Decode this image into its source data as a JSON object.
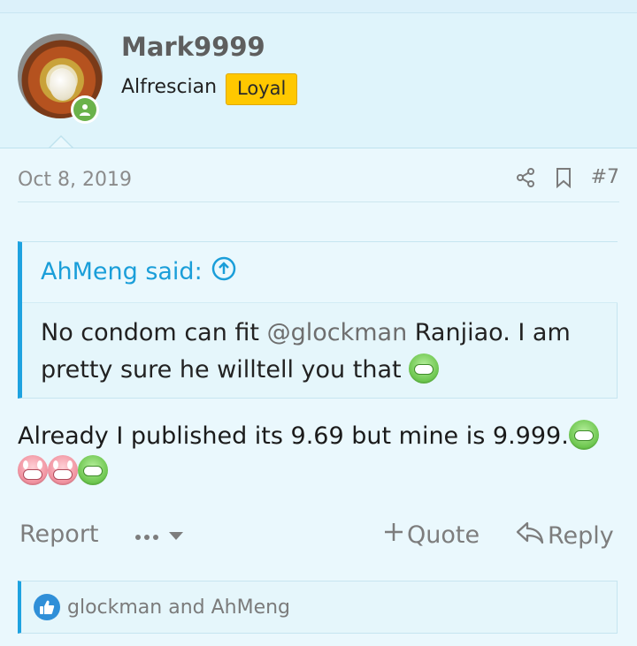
{
  "user": {
    "name": "Mark9999",
    "title": "Alfrescian",
    "badge": "Loyal"
  },
  "post": {
    "date": "Oct 8, 2019",
    "number": "#7",
    "text": "Already I published its 9.69 but mine is 9.999."
  },
  "quote": {
    "author": "AhMeng said:",
    "text_before": "No condom can fit ",
    "mention": "@glockman",
    "text_after": " Ranjiao. I am pretty sure he willtell you that"
  },
  "actions": {
    "report": "Report",
    "quote": "Quote",
    "reply": "Reply"
  },
  "reactions": {
    "text": "glockman and AhMeng"
  },
  "colors": {
    "accent": "#1ea2e0",
    "badge": "#ffc800",
    "online": "#6ab24a"
  },
  "icons": [
    "share-icon",
    "bookmark-icon",
    "arrow-up-circle-icon",
    "more-dots-icon",
    "plus-icon",
    "reply-arrow-icon",
    "like-icon",
    "grin-emoji",
    "crying-emoji"
  ]
}
